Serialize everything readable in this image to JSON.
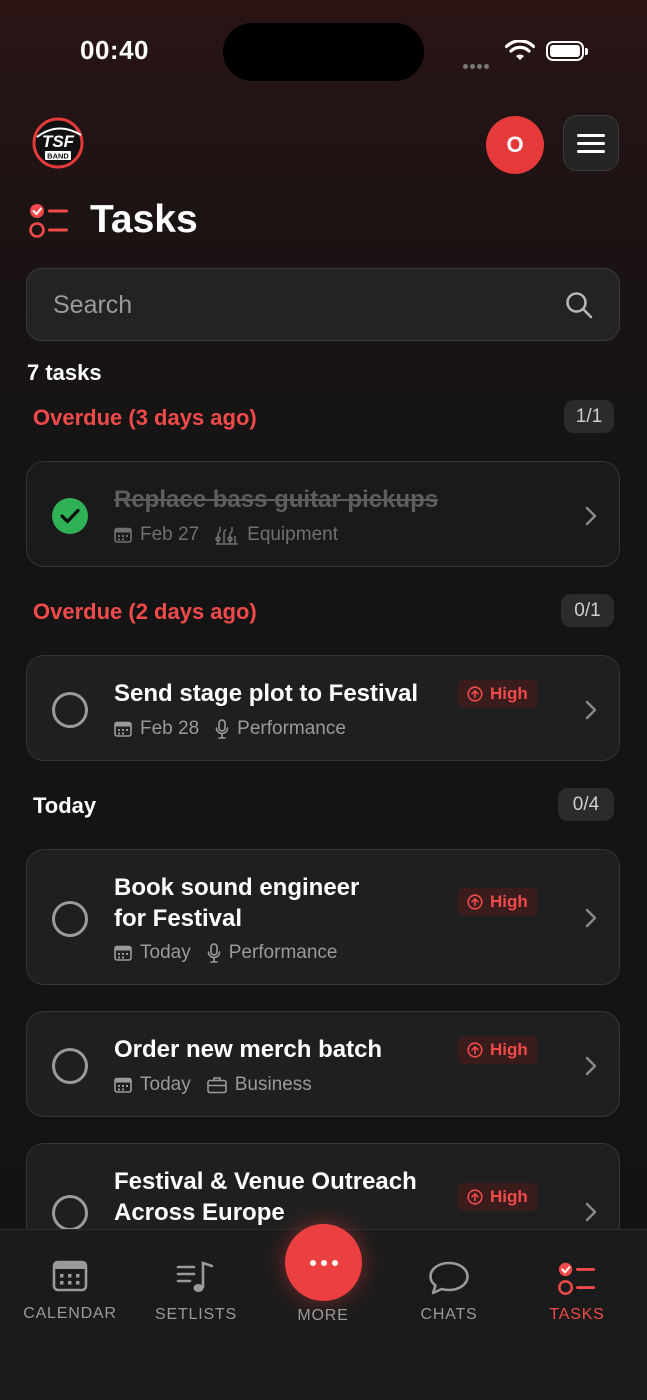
{
  "status": {
    "time": "00:40"
  },
  "header": {
    "logo_text": "TSF",
    "logo_subtext": "BAND",
    "avatar_initial": "O"
  },
  "page": {
    "title": "Tasks"
  },
  "search": {
    "placeholder": "Search",
    "value": ""
  },
  "task_count": "7 tasks",
  "colors": {
    "accent": "#f04a4a",
    "success": "#2fb155",
    "background": "#141414",
    "card": "#1f1f1f"
  },
  "sections": [
    {
      "label": "Overdue (3 days ago)",
      "progress": "1/1",
      "tasks": [
        {
          "title": "Replace bass guitar pickups",
          "date": "Feb 27",
          "category": "Equipment",
          "category_icon": "guitar-icon",
          "completed": true,
          "priority": ""
        }
      ]
    },
    {
      "label": "Overdue (2 days ago)",
      "progress": "0/1",
      "tasks": [
        {
          "title": "Send stage plot to Festival",
          "date": "Feb 28",
          "category": "Performance",
          "category_icon": "microphone-icon",
          "completed": false,
          "priority": "High"
        }
      ]
    },
    {
      "label": "Today",
      "progress": "0/4",
      "tasks": [
        {
          "title_line1": "Book sound engineer",
          "title_line2": "for Festival",
          "date": "Today",
          "category": "Performance",
          "category_icon": "microphone-icon",
          "completed": false,
          "priority": "High"
        },
        {
          "title": "Order new merch batch",
          "date": "Today",
          "category": "Business",
          "category_icon": "briefcase-icon",
          "completed": false,
          "priority": "High"
        },
        {
          "title_line1": "Festival & Venue Outreach",
          "title_line2": "Across Europe",
          "completed": false,
          "priority": "High"
        }
      ]
    }
  ],
  "nav": {
    "calendar": "CALENDAR",
    "setlists": "SETLISTS",
    "more": "MORE",
    "chats": "CHATS",
    "tasks": "TASKS",
    "active": "tasks"
  }
}
